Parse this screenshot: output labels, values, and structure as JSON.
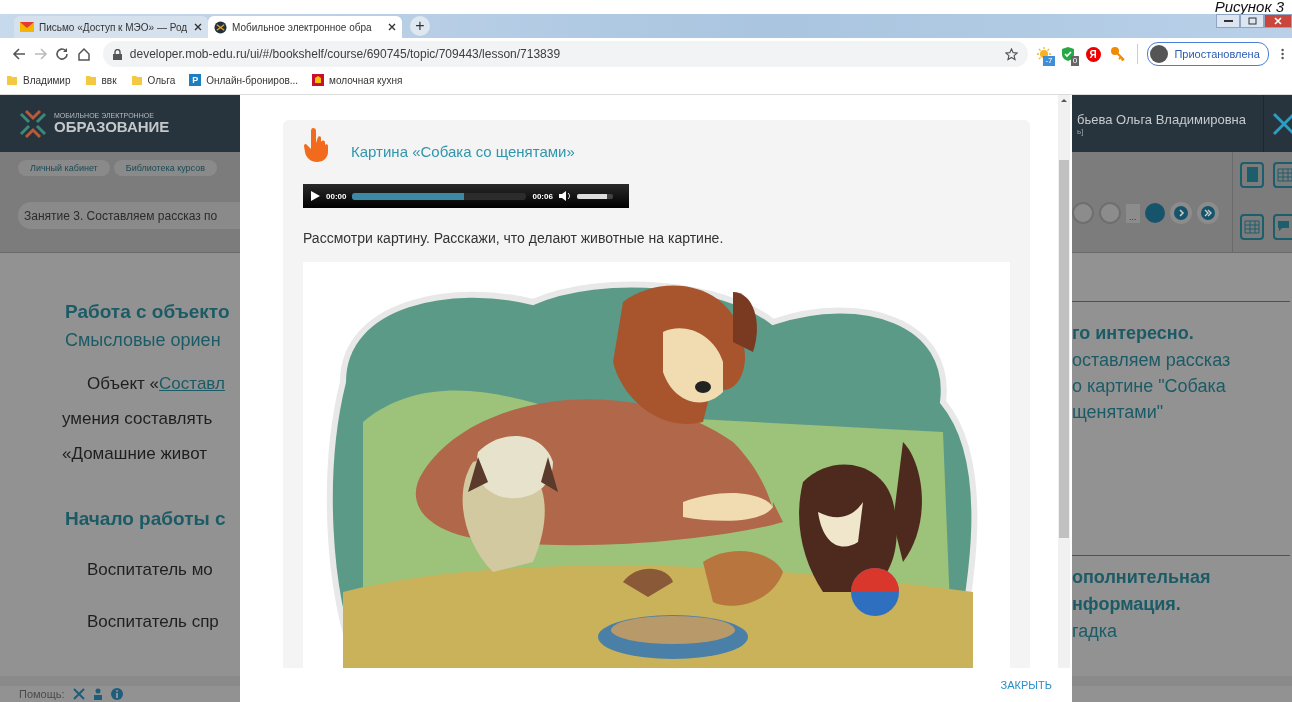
{
  "caption": "Рисунок 3",
  "browser": {
    "tabs": [
      {
        "title": "Письмо «Доступ к МЭО» — Род",
        "kind": "mail",
        "selected": false
      },
      {
        "title": "Мобильное электронное обра",
        "kind": "site",
        "selected": true
      }
    ],
    "new_tab": "+",
    "url": "developer.mob-edu.ru/ui/#/bookshelf/course/690745/topic/709443/lesson/713839",
    "extensions": [
      {
        "kind": "weather",
        "badge": "-7"
      },
      {
        "kind": "shield",
        "badge": "0"
      },
      {
        "kind": "yandex",
        "badge": "Я"
      },
      {
        "kind": "key"
      }
    ],
    "profile": "Приостановлена",
    "bookmarks": [
      {
        "kind": "folder",
        "label": "Владимир"
      },
      {
        "kind": "folder",
        "label": "ввк"
      },
      {
        "kind": "folder",
        "label": "Ольга"
      },
      {
        "kind": "letter",
        "icon_text": "P",
        "label": "Онлайн-брониров..."
      },
      {
        "kind": "emblem",
        "label": "молочная кухня"
      }
    ]
  },
  "page": {
    "logo": {
      "line1": "МОБИЛЬНОЕ ЭЛЕКТРОННОЕ",
      "line2": "ОБРАЗОВАНИЕ"
    },
    "user": {
      "name": "бьева Ольга Владимировна",
      "role": "ь]"
    },
    "breadcrumbs": [
      "Личный кабинет",
      "Библиотека курсов"
    ],
    "lesson_title": "Занятие 3. Составляем рассказ по",
    "pagination": {
      "ellipsis": "..."
    },
    "left_content": [
      {
        "kind": "heading",
        "text": "Работа с объекто"
      },
      {
        "kind": "subheading",
        "text": "Смысловые ориен"
      },
      {
        "kind": "link_line",
        "text": "Объект «",
        "link": "Составл"
      },
      {
        "kind": "line",
        "text": "умения составлять"
      },
      {
        "kind": "line",
        "text": "«Домашние живот"
      },
      {
        "kind": "heading2",
        "text": "Начало работы с"
      },
      {
        "kind": "para",
        "text": "Воспитатель мо"
      },
      {
        "kind": "para",
        "text": "Воспитатель спр"
      }
    ],
    "right_content": [
      {
        "kind": "bold",
        "text": "го интересно."
      },
      {
        "kind": "line",
        "text": "оставляем рассказ"
      },
      {
        "kind": "line",
        "text": "о картине \"Собака"
      },
      {
        "kind": "line",
        "text": "щенятами\""
      },
      {
        "kind": "rule"
      },
      {
        "kind": "bold",
        "text": "ополнительная"
      },
      {
        "kind": "bold",
        "text": "нформация."
      },
      {
        "kind": "line",
        "text": "гадка"
      }
    ],
    "help_label": "Помощь:"
  },
  "modal": {
    "title": "Картина «Собака со щенятами»",
    "audio": {
      "current": "00:00",
      "duration": "00:06",
      "level": 0.64,
      "volume": {
        "level": 0.83
      }
    },
    "instruction": "Рассмотри картину. Расскажи, что делают животные на картине.",
    "close": "ЗАКРЫТЬ"
  }
}
